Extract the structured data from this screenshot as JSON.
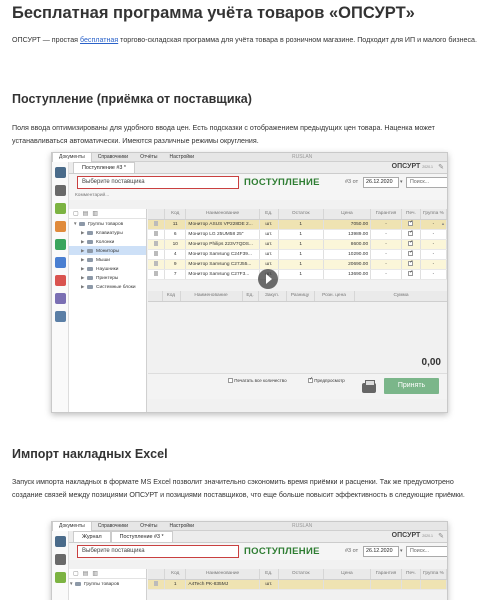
{
  "page": {
    "title": "Бесплатная программа учёта товаров «ОПСУРТ»",
    "intro_before_link": "ОПСУРТ — простая ",
    "intro_link": "бесплатная",
    "intro_after_link": " торгово-складская программа для учёта товара в розничном магазине. Подходит для ИП и малого бизнеса.",
    "section1_title": "Поступление (приёмка от поставщика)",
    "section1_text": "Поля ввода оптимизированы для удобного ввода цен. Есть подсказки с отображением предыдущих цен товара. Наценка может устанавливаться автоматически. Имеются различные режимы округления.",
    "section2_title": "Импорт накладных Excel",
    "section2_text": "Запуск импорта накладных в формате MS Excel позволит значительно сэкономить время приёмки и расценки. Так же предусмотрено создание связей между позициями ОПСУРТ и позициями поставщиков, что еще больше повысит эффективность в следующие приёмки."
  },
  "app1": {
    "menu": [
      "Документы",
      "Справочники",
      "Отчёты",
      "Настройки"
    ],
    "menu_center": "RUSLAN",
    "tab": "Поступление #3 *",
    "logo": "ОПСУРТ",
    "logo_ver": "2020.1",
    "supplier_placeholder": "Выберите поставщика",
    "doc_title": "ПОСТУПЛЕНИЕ",
    "doc_num": "#3",
    "doc_num_suffix": "от",
    "date": "26.12.2020",
    "search_placeholder": "Поиск...",
    "comment": "Комментарий...",
    "tree": [
      {
        "label": "Группы товаров",
        "level": 0,
        "open": true
      },
      {
        "label": "Клавиатуры",
        "level": 1
      },
      {
        "label": "Колонки",
        "level": 1
      },
      {
        "label": "Мониторы",
        "level": 1,
        "selected": true
      },
      {
        "label": "Мыши",
        "level": 1
      },
      {
        "label": "Наушники",
        "level": 1
      },
      {
        "label": "Принтеры",
        "level": 1
      },
      {
        "label": "Системные блоки",
        "level": 1
      }
    ],
    "columns": [
      "Код",
      "Наименование",
      "Ед.",
      "Остаток",
      "Цена",
      "Гарантия",
      "Печ.",
      "Группа %"
    ],
    "rows": [
      {
        "code": "11",
        "name": "Монитор ASUS VP228DE 2...",
        "unit": "шт.",
        "stock": "1",
        "price": "7050.00",
        "warranty": "-",
        "print": true,
        "group": "-"
      },
      {
        "code": "6",
        "name": "Монитор LG 25UM58 25\"",
        "unit": "шт.",
        "stock": "1",
        "price": "13989.00",
        "warranty": "-",
        "print": true,
        "group": "-"
      },
      {
        "code": "10",
        "name": "Монитор Philips 223V7QDS...",
        "unit": "шт.",
        "stock": "1",
        "price": "8600.00",
        "warranty": "-",
        "print": true,
        "group": "-"
      },
      {
        "code": "4",
        "name": "Монитор Samsung C24F39...",
        "unit": "шт.",
        "stock": "1",
        "price": "10290.00",
        "warranty": "-",
        "print": true,
        "group": "-"
      },
      {
        "code": "9",
        "name": "Монитор Samsung C27J55...",
        "unit": "шт.",
        "stock": "1",
        "price": "20690.00",
        "warranty": "-",
        "print": true,
        "group": "-"
      },
      {
        "code": "7",
        "name": "Монитор Samsung C27F3...",
        "unit": "шт.",
        "stock": "1",
        "price": "13690.00",
        "warranty": "-",
        "print": true,
        "group": "-"
      }
    ],
    "doc_columns": [
      "Код",
      "Наименование",
      "Ед.",
      "Закуп.",
      "Разницу",
      "Розн. цена",
      "Сумма"
    ],
    "total": "0,00",
    "print_all_label": "Печатать все количество",
    "preview_label": "Предпросмотр",
    "accept_button": "Принять"
  },
  "app2": {
    "menu": [
      "Документы",
      "Справочники",
      "Отчёты",
      "Настройки"
    ],
    "menu_center": "RUSLAN",
    "tab1": "Журнал",
    "tab2": "Поступление #3 *",
    "logo": "ОПСУРТ",
    "logo_ver": "2020.1",
    "supplier_placeholder": "Выберите поставщика",
    "doc_title": "ПОСТУПЛЕНИЕ",
    "doc_num": "#3",
    "doc_num_suffix": "от",
    "date": "26.12.2020",
    "search_placeholder": "Поиск...",
    "tree_first": "Группы товаров",
    "columns": [
      "Код",
      "Наименование",
      "Ед.",
      "Остаток",
      "Цена",
      "Гарантия",
      "Печ.",
      "Группа %"
    ],
    "first_row": {
      "code": "1",
      "name": "A4Tech PK-835MJ",
      "unit": "шт."
    }
  },
  "colors": {
    "doc_title_green": "#2e7d32",
    "accept_green": "#7bb68a",
    "link_blue": "#2a62c9",
    "supplier_border_red": "#c94040"
  }
}
